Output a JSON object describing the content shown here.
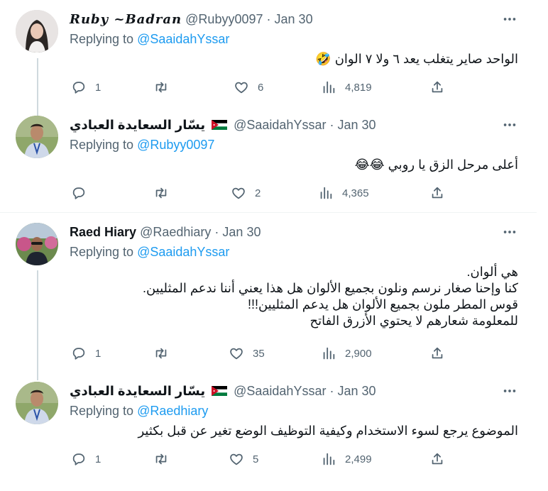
{
  "tweets": [
    {
      "name": "Ruby ~Badran",
      "handle": "@Rubyy0097",
      "date": "Jan 30",
      "replying_label": "Replying to",
      "replying_to": "@SaaidahYssar",
      "text": [
        "الواحد صاير يتغلب يعد ٦ ولا ٧ الوان 🤣"
      ],
      "replies": "1",
      "retweets": "",
      "likes": "6",
      "views": "4,819"
    },
    {
      "name": "يسّار السعايدة العبادي",
      "flag": "jordan-flag",
      "handle": "@SaaidahYssar",
      "date": "Jan 30",
      "replying_label": "Replying to",
      "replying_to": "@Rubyy0097",
      "text": [
        "أعلى مرحل الزق يا روبي 😂😂"
      ],
      "replies": "",
      "retweets": "",
      "likes": "2",
      "views": "4,365"
    },
    {
      "name": "Raed Hiary",
      "handle": "@Raedhiary",
      "date": "Jan 30",
      "replying_label": "Replying to",
      "replying_to": "@SaaidahYssar",
      "text": [
        "هي ألوان.",
        "كنا وإحنا صغار نرسم ونلون بجميع الألوان هل هذا يعني أننا ندعم المثليين.",
        "قوس المطر ملون بجميع الألوان هل يدعم المثليين!!!",
        "للمعلومة شعارهم لا يحتوي الأزرق الفاتح"
      ],
      "replies": "1",
      "retweets": "",
      "likes": "35",
      "views": "2,900"
    },
    {
      "name": "يسّار السعايدة العبادي",
      "flag": "jordan-flag",
      "handle": "@SaaidahYssar",
      "date": "Jan 30",
      "replying_label": "Replying to",
      "replying_to": "@Raedhiary",
      "text": [
        "الموضوع يرجع لسوء الاستخدام وكيفية التوظيف الوضع تغير عن قبل بكثير"
      ],
      "replies": "1",
      "retweets": "",
      "likes": "5",
      "views": "2,499"
    }
  ],
  "separator": "·",
  "icons": {
    "more": "more-icon",
    "reply": "reply-icon",
    "retweet": "retweet-icon",
    "like": "like-icon",
    "views": "views-icon",
    "share": "share-icon"
  },
  "colors": {
    "link": "#1d9bf0",
    "secondary": "#536471",
    "text": "#0f1419",
    "thread_line": "#cfd9de",
    "divider": "#eff3f4"
  }
}
